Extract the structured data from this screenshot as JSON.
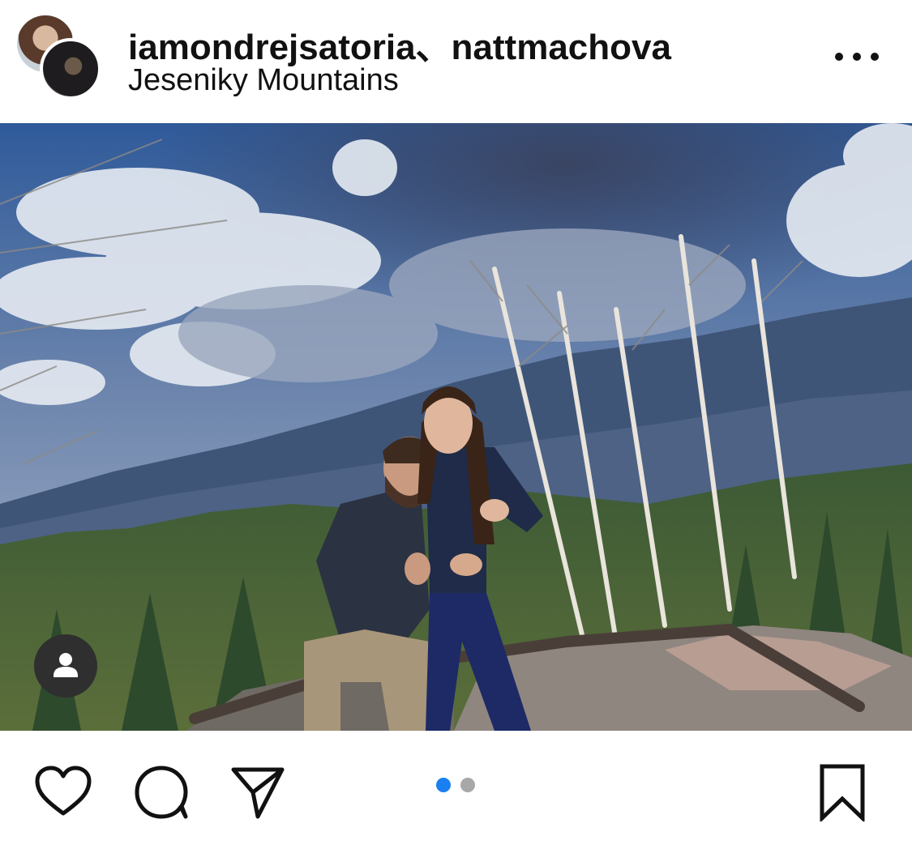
{
  "header": {
    "usernames": "iamondrejsatoria、nattmachova",
    "location": "Jeseniky Mountains",
    "avatars": [
      "user-avatar-1",
      "user-avatar-2"
    ],
    "more_icon": "more-options-icon"
  },
  "photo": {
    "tag_icon": "person-tag-icon"
  },
  "actions": {
    "like_icon": "heart-icon",
    "comment_icon": "comment-bubble-icon",
    "share_icon": "paper-plane-icon",
    "save_icon": "bookmark-icon"
  },
  "carousel": {
    "total": 2,
    "active": 1
  },
  "colors": {
    "text": "#111111",
    "active_dot": "#1a7ff0",
    "inactive_dot": "#a8a8a8",
    "tag_badge": "#2f2f2f"
  }
}
